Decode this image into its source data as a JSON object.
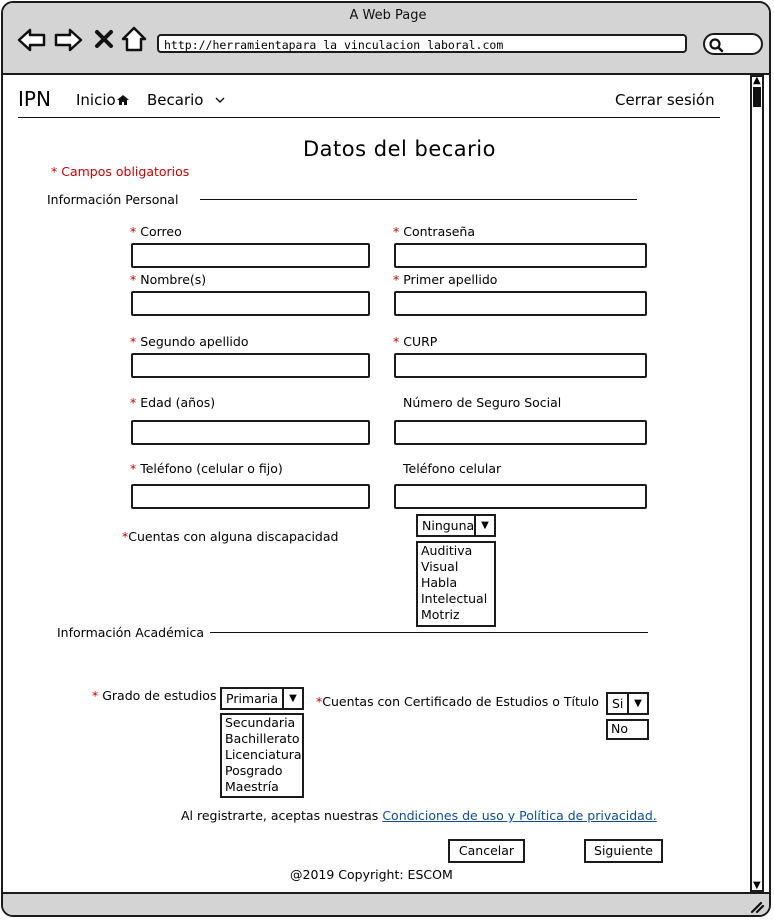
{
  "browser": {
    "window_title": "A Web Page",
    "url": "http://herramientapara la vinculacion laboral.com",
    "icons": [
      "back-arrow-icon",
      "forward-arrow-icon",
      "close-icon",
      "home-icon",
      "search-icon"
    ]
  },
  "nav": {
    "brand": "IPN",
    "inicio": "Inicio",
    "becario": "Becario",
    "cerrar_sesion": "Cerrar sesión"
  },
  "page": {
    "title": "Datos del becario",
    "required_mark": "*",
    "required_note": "Campos obligatorios",
    "section_personal": "Información Personal",
    "section_academica": "Información Académica"
  },
  "fields": {
    "correo": "Correo",
    "contrasena": "Contraseña",
    "nombre": "Nombre(s)",
    "primer_apellido": "Primer apellido",
    "segundo_apellido": "Segundo apellido",
    "curp": "CURP",
    "edad": "Edad (años)",
    "nss": "Número de Seguro Social",
    "telefono": "Teléfono (celular o fijo)",
    "telefono_celular": "Teléfono celular"
  },
  "discapacidad": {
    "label": "Cuentas con alguna discapacidad",
    "selected": "Ninguna",
    "options": [
      "Auditiva",
      "Visual",
      "Habla",
      "Intelectual",
      "Motriz"
    ]
  },
  "grado": {
    "label": "Grado de estudios",
    "selected": "Primaria",
    "options": [
      "Secundaria",
      "Bachillerato",
      "Licenciatura",
      "Posgrado",
      "Maestría"
    ]
  },
  "certificado": {
    "label": "Cuentas con Certificado de Estudios o Título",
    "selected": "Si",
    "options": [
      "No"
    ]
  },
  "footer": {
    "terms_prefix": "Al registrarte, aceptas nuestras",
    "terms_link": "Condiciones de uso y Política de privacidad.",
    "cancel": "Cancelar",
    "next": "Siguiente",
    "copyright": "@2019 Copyright: ESCOM"
  },
  "colors": {
    "required": "#cc0000",
    "link": "#0b4f9c",
    "chrome": "#d4d4d4"
  }
}
